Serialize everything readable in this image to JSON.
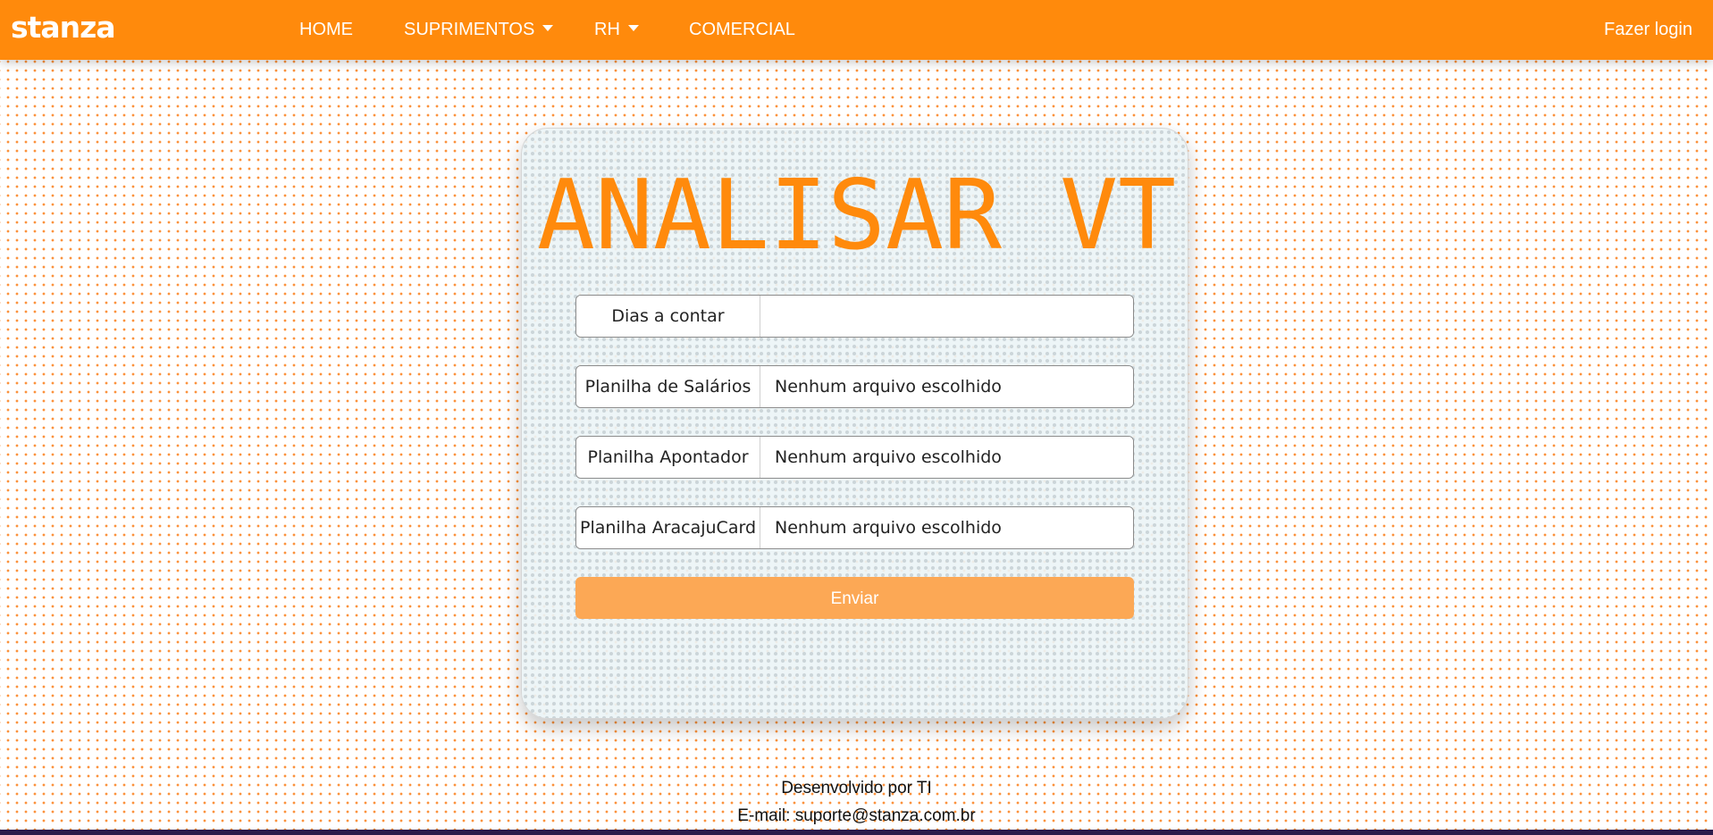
{
  "navbar": {
    "brand": "stanza",
    "items": [
      {
        "label": "HOME",
        "has_dropdown": false
      },
      {
        "label": "SUPRIMENTOS",
        "has_dropdown": true
      },
      {
        "label": "RH",
        "has_dropdown": true
      },
      {
        "label": "COMERCIAL",
        "has_dropdown": false
      }
    ],
    "login_label": "Fazer login",
    "color": "#ff8a0c"
  },
  "form": {
    "title": "ANALISAR VT",
    "fields": [
      {
        "label": "Dias a contar",
        "value": "",
        "type": "number"
      },
      {
        "label": "Planilha de Salários",
        "value": "Nenhum arquivo escolhido",
        "type": "file"
      },
      {
        "label": "Planilha Apontador",
        "value": "Nenhum arquivo escolhido",
        "type": "file"
      },
      {
        "label": "Planilha AracajuCard",
        "value": "Nenhum arquivo escolhido",
        "type": "file"
      }
    ],
    "submit_label": "Enviar",
    "accent_color": "#ff8a0c",
    "button_color": "#fca855"
  },
  "footer": {
    "developed_by": "Desenvolvido por TI",
    "email": "E-mail: suporte@stanza.com.br"
  },
  "icons": {
    "dropdown": "caret-down-icon"
  }
}
